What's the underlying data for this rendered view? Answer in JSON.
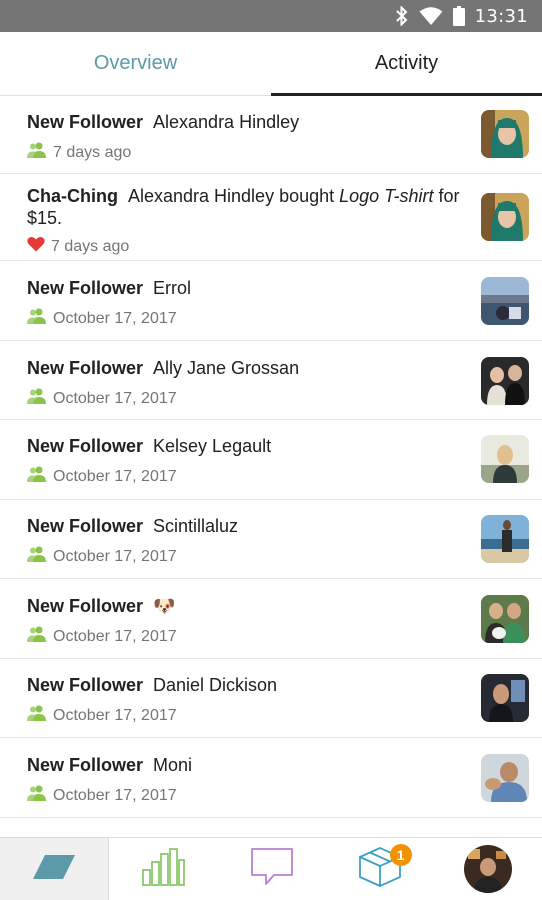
{
  "status_bar": {
    "time": "13:31"
  },
  "tabs": [
    {
      "label": "Overview",
      "selected": false
    },
    {
      "label": "Activity",
      "selected": true
    }
  ],
  "activity": [
    {
      "kind": "New Follower",
      "text": "Alexandra Hindley",
      "meta": "7 days ago",
      "icon": "follower-icon"
    },
    {
      "kind": "Cha-Ching",
      "text_before": "Alexandra Hindley bought ",
      "text_italic": "Logo T-shirt",
      "text_after": " for $15.",
      "meta": "7 days ago",
      "icon": "heart-icon"
    },
    {
      "kind": "New Follower",
      "text": "Errol",
      "meta": "October 17, 2017",
      "icon": "follower-icon"
    },
    {
      "kind": "New Follower",
      "text": "Ally Jane Grossan",
      "meta": "October 17, 2017",
      "icon": "follower-icon"
    },
    {
      "kind": "New Follower",
      "text": "Kelsey Legault",
      "meta": "October 17, 2017",
      "icon": "follower-icon"
    },
    {
      "kind": "New Follower",
      "text": "Scintillaluz",
      "meta": "October 17, 2017",
      "icon": "follower-icon"
    },
    {
      "kind": "New Follower",
      "text": "🐶",
      "meta": "October 17, 2017",
      "icon": "follower-icon"
    },
    {
      "kind": "New Follower",
      "text": "Daniel Dickison",
      "meta": "October 17, 2017",
      "icon": "follower-icon"
    },
    {
      "kind": "New Follower",
      "text": "Moni",
      "meta": "October 17, 2017",
      "icon": "follower-icon"
    }
  ],
  "bottom_nav": [
    {
      "icon": "home-parallelogram-icon",
      "selected": true
    },
    {
      "icon": "bar-chart-icon",
      "selected": false
    },
    {
      "icon": "chat-bubble-icon",
      "selected": false
    },
    {
      "icon": "box-icon",
      "selected": false,
      "badge": "1"
    },
    {
      "icon": "profile-avatar",
      "selected": false
    }
  ],
  "colors": {
    "accent": "#5b9aa6",
    "follower_green": "#8bc34a",
    "heart_red": "#e53935",
    "badge_orange": "#f39200",
    "chart_green": "#7cc25a",
    "chat_purple": "#b77fd6",
    "box_blue": "#3aa0c8"
  }
}
